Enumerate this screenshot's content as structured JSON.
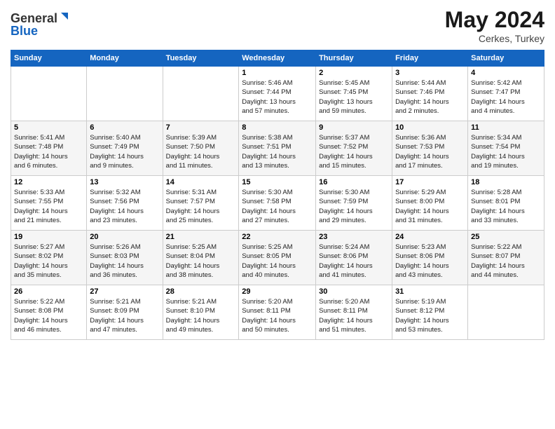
{
  "header": {
    "logo_text_general": "General",
    "logo_text_blue": "Blue",
    "month_year": "May 2024",
    "location": "Cerkes, Turkey"
  },
  "weekdays": [
    "Sunday",
    "Monday",
    "Tuesday",
    "Wednesday",
    "Thursday",
    "Friday",
    "Saturday"
  ],
  "weeks": [
    [
      {
        "day": "",
        "info": ""
      },
      {
        "day": "",
        "info": ""
      },
      {
        "day": "",
        "info": ""
      },
      {
        "day": "1",
        "info": "Sunrise: 5:46 AM\nSunset: 7:44 PM\nDaylight: 13 hours\nand 57 minutes."
      },
      {
        "day": "2",
        "info": "Sunrise: 5:45 AM\nSunset: 7:45 PM\nDaylight: 13 hours\nand 59 minutes."
      },
      {
        "day": "3",
        "info": "Sunrise: 5:44 AM\nSunset: 7:46 PM\nDaylight: 14 hours\nand 2 minutes."
      },
      {
        "day": "4",
        "info": "Sunrise: 5:42 AM\nSunset: 7:47 PM\nDaylight: 14 hours\nand 4 minutes."
      }
    ],
    [
      {
        "day": "5",
        "info": "Sunrise: 5:41 AM\nSunset: 7:48 PM\nDaylight: 14 hours\nand 6 minutes."
      },
      {
        "day": "6",
        "info": "Sunrise: 5:40 AM\nSunset: 7:49 PM\nDaylight: 14 hours\nand 9 minutes."
      },
      {
        "day": "7",
        "info": "Sunrise: 5:39 AM\nSunset: 7:50 PM\nDaylight: 14 hours\nand 11 minutes."
      },
      {
        "day": "8",
        "info": "Sunrise: 5:38 AM\nSunset: 7:51 PM\nDaylight: 14 hours\nand 13 minutes."
      },
      {
        "day": "9",
        "info": "Sunrise: 5:37 AM\nSunset: 7:52 PM\nDaylight: 14 hours\nand 15 minutes."
      },
      {
        "day": "10",
        "info": "Sunrise: 5:36 AM\nSunset: 7:53 PM\nDaylight: 14 hours\nand 17 minutes."
      },
      {
        "day": "11",
        "info": "Sunrise: 5:34 AM\nSunset: 7:54 PM\nDaylight: 14 hours\nand 19 minutes."
      }
    ],
    [
      {
        "day": "12",
        "info": "Sunrise: 5:33 AM\nSunset: 7:55 PM\nDaylight: 14 hours\nand 21 minutes."
      },
      {
        "day": "13",
        "info": "Sunrise: 5:32 AM\nSunset: 7:56 PM\nDaylight: 14 hours\nand 23 minutes."
      },
      {
        "day": "14",
        "info": "Sunrise: 5:31 AM\nSunset: 7:57 PM\nDaylight: 14 hours\nand 25 minutes."
      },
      {
        "day": "15",
        "info": "Sunrise: 5:30 AM\nSunset: 7:58 PM\nDaylight: 14 hours\nand 27 minutes."
      },
      {
        "day": "16",
        "info": "Sunrise: 5:30 AM\nSunset: 7:59 PM\nDaylight: 14 hours\nand 29 minutes."
      },
      {
        "day": "17",
        "info": "Sunrise: 5:29 AM\nSunset: 8:00 PM\nDaylight: 14 hours\nand 31 minutes."
      },
      {
        "day": "18",
        "info": "Sunrise: 5:28 AM\nSunset: 8:01 PM\nDaylight: 14 hours\nand 33 minutes."
      }
    ],
    [
      {
        "day": "19",
        "info": "Sunrise: 5:27 AM\nSunset: 8:02 PM\nDaylight: 14 hours\nand 35 minutes."
      },
      {
        "day": "20",
        "info": "Sunrise: 5:26 AM\nSunset: 8:03 PM\nDaylight: 14 hours\nand 36 minutes."
      },
      {
        "day": "21",
        "info": "Sunrise: 5:25 AM\nSunset: 8:04 PM\nDaylight: 14 hours\nand 38 minutes."
      },
      {
        "day": "22",
        "info": "Sunrise: 5:25 AM\nSunset: 8:05 PM\nDaylight: 14 hours\nand 40 minutes."
      },
      {
        "day": "23",
        "info": "Sunrise: 5:24 AM\nSunset: 8:06 PM\nDaylight: 14 hours\nand 41 minutes."
      },
      {
        "day": "24",
        "info": "Sunrise: 5:23 AM\nSunset: 8:06 PM\nDaylight: 14 hours\nand 43 minutes."
      },
      {
        "day": "25",
        "info": "Sunrise: 5:22 AM\nSunset: 8:07 PM\nDaylight: 14 hours\nand 44 minutes."
      }
    ],
    [
      {
        "day": "26",
        "info": "Sunrise: 5:22 AM\nSunset: 8:08 PM\nDaylight: 14 hours\nand 46 minutes."
      },
      {
        "day": "27",
        "info": "Sunrise: 5:21 AM\nSunset: 8:09 PM\nDaylight: 14 hours\nand 47 minutes."
      },
      {
        "day": "28",
        "info": "Sunrise: 5:21 AM\nSunset: 8:10 PM\nDaylight: 14 hours\nand 49 minutes."
      },
      {
        "day": "29",
        "info": "Sunrise: 5:20 AM\nSunset: 8:11 PM\nDaylight: 14 hours\nand 50 minutes."
      },
      {
        "day": "30",
        "info": "Sunrise: 5:20 AM\nSunset: 8:11 PM\nDaylight: 14 hours\nand 51 minutes."
      },
      {
        "day": "31",
        "info": "Sunrise: 5:19 AM\nSunset: 8:12 PM\nDaylight: 14 hours\nand 53 minutes."
      },
      {
        "day": "",
        "info": ""
      }
    ]
  ]
}
